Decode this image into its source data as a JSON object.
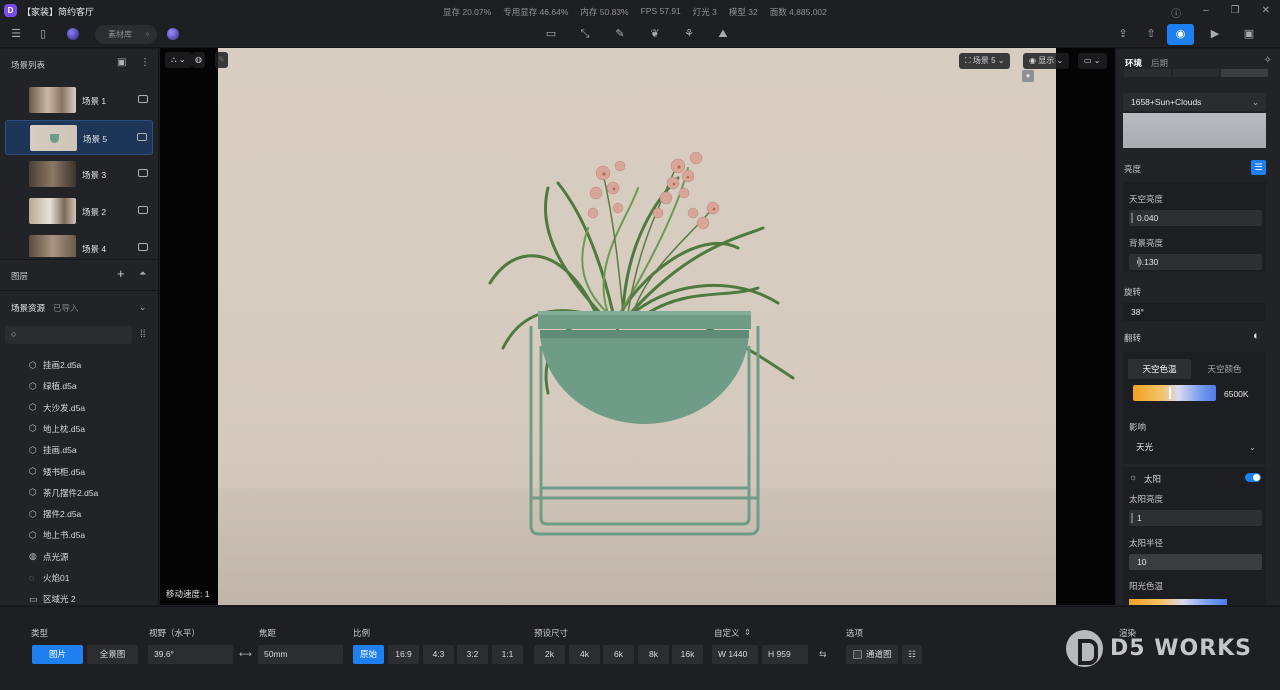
{
  "app": {
    "title": "【家装】简约客厅",
    "logo_letter": "D"
  },
  "stats": [
    "显存 20.07%",
    "专用显存 46.64%",
    "内存 50.83%",
    "FPS 57.91",
    "灯光 3",
    "模型 32",
    "面数 4,885,002"
  ],
  "toolbar": {
    "material_lib": "素材库"
  },
  "left": {
    "scene_list_title": "场景列表",
    "scenes": [
      {
        "label": "场景 1",
        "active": false
      },
      {
        "label": "场景 5",
        "active": true
      },
      {
        "label": "场景 3",
        "active": false
      },
      {
        "label": "场景 2",
        "active": false
      },
      {
        "label": "场景 4",
        "active": false
      }
    ],
    "layers_title": "图层",
    "assets_tab": "场景资源",
    "imported_tab": "已导入",
    "assets": [
      {
        "label": "挂画2.d5a",
        "icon": "cube-icon"
      },
      {
        "label": "绿植.d5a",
        "icon": "cube-icon"
      },
      {
        "label": "大沙发.d5a",
        "icon": "cube-icon"
      },
      {
        "label": "地上枕.d5a",
        "icon": "cube-icon"
      },
      {
        "label": "挂画.d5a",
        "icon": "cube-icon"
      },
      {
        "label": "矮书柜.d5a",
        "icon": "cube-icon"
      },
      {
        "label": "茶几摆件2.d5a",
        "icon": "cube-icon"
      },
      {
        "label": "摆件2.d5a",
        "icon": "cube-icon"
      },
      {
        "label": "地上书.d5a",
        "icon": "cube-icon"
      },
      {
        "label": "点光源",
        "icon": "point-light-icon"
      },
      {
        "label": "火焰01",
        "icon": "flame-icon"
      },
      {
        "label": "区域光 2",
        "icon": "area-light-icon"
      }
    ]
  },
  "viewport": {
    "scene_select": "场景 5",
    "display_btn": "显示",
    "move_speed": "移动速度: 1"
  },
  "right": {
    "tab_env": "环境",
    "tab_post": "后期",
    "hdri": "1658+Sun+Clouds",
    "brightness": "亮度",
    "sky_brightness_label": "天空亮度",
    "sky_brightness": "0.040",
    "bg_brightness_label": "背景亮度",
    "bg_brightness": "0.130",
    "rotation_label": "旋转",
    "rotation": "38°",
    "flip_label": "翻转",
    "sky_temp_tab": "天空色温",
    "sky_color_tab": "天空颜色",
    "temp_value": "6500K",
    "influence_label": "影响",
    "influence_value": "天光",
    "sun_label": "太阳",
    "sun_brightness_label": "太阳亮度",
    "sun_brightness": "1",
    "sun_radius_label": "太阳半径",
    "sun_radius": "10",
    "sun_color_temp_label": "阳光色温"
  },
  "bottom": {
    "type_label": "类型",
    "type_photo": "图片",
    "type_pano": "全景图",
    "fov_label": "视野（水平）",
    "fov_value": "39.6°",
    "focal_label": "焦距",
    "focal_value": "50mm",
    "ratio_label": "比例",
    "ratios": [
      "原始",
      "16:9",
      "4:3",
      "3:2",
      "1:1"
    ],
    "preset_label": "预设尺寸",
    "presets": [
      "2k",
      "4k",
      "6k",
      "8k",
      "16k"
    ],
    "custom_label": "自定义",
    "width_value": "W  1440",
    "height_value": "H  959",
    "options_label": "选项",
    "channel_label": "通道图",
    "render_label": "渲染",
    "watermark": "D5 WORKS"
  },
  "colors": {
    "accent": "#1d7ff0",
    "active_scene": "#1d3557",
    "pot": "#6f9c87"
  }
}
